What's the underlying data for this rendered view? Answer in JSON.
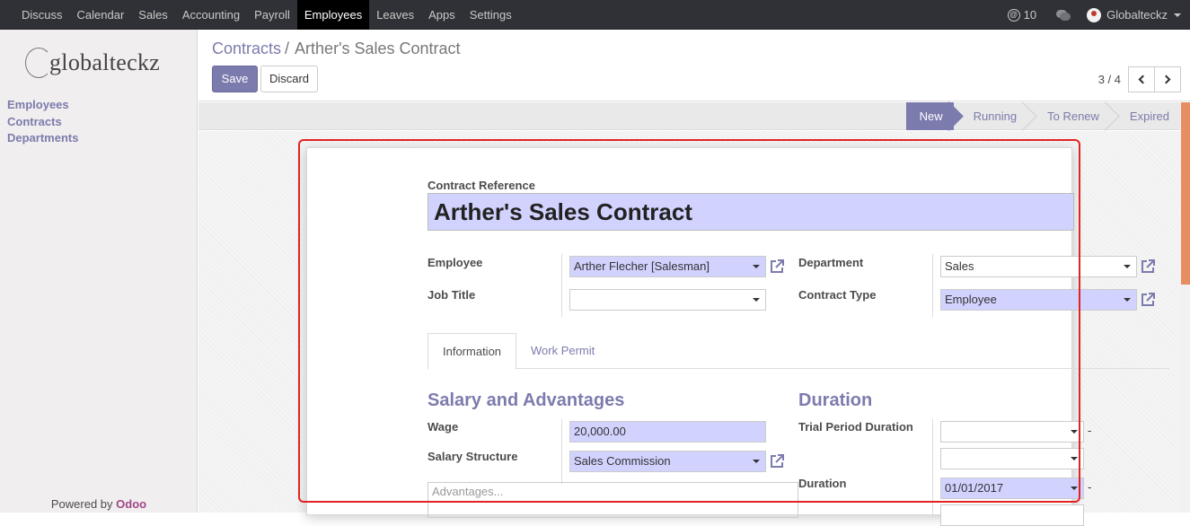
{
  "menu": [
    "Discuss",
    "Calendar",
    "Sales",
    "Accounting",
    "Payroll",
    "Employees",
    "Leaves",
    "Apps",
    "Settings"
  ],
  "active_menu": "Employees",
  "topbar": {
    "mentions_symbol": "@",
    "mentions_count": "10",
    "user_name": "Globalteckz"
  },
  "sidebar": {
    "logo_text": "globalteckz",
    "links": [
      "Employees",
      "Contracts",
      "Departments"
    ],
    "powered_by": "Powered by",
    "odoo": "Odoo"
  },
  "breadcrumb": {
    "parent": "Contracts",
    "separator": "/",
    "current": "Arther's Sales Contract"
  },
  "buttons": {
    "save": "Save",
    "discard": "Discard"
  },
  "pager": {
    "value": "3 / 4"
  },
  "status_stages": [
    "New",
    "Running",
    "To Renew",
    "Expired"
  ],
  "active_stage": "New",
  "form": {
    "contract_reference_label": "Contract Reference",
    "contract_reference": "Arther's Sales Contract",
    "employee_label": "Employee",
    "employee_value": "Arther Flecher [Salesman]",
    "job_title_label": "Job Title",
    "job_title_value": "",
    "department_label": "Department",
    "department_value": "Sales",
    "contract_type_label": "Contract Type",
    "contract_type_value": "Employee"
  },
  "tabs": [
    "Information",
    "Work Permit"
  ],
  "active_tab": "Information",
  "salary": {
    "title": "Salary and Advantages",
    "wage_label": "Wage",
    "wage_value": "20,000.00",
    "structure_label": "Salary Structure",
    "structure_value": "Sales Commission",
    "advantages_placeholder": "Advantages..."
  },
  "duration": {
    "title": "Duration",
    "trial_label": "Trial Period Duration",
    "trial_start": "",
    "trial_end": "",
    "duration_label": "Duration",
    "duration_start": "01/01/2017",
    "dash": "-"
  },
  "colors": {
    "brand": "#7c7bad",
    "topbar": "#2f3136",
    "required_field": "#d2d2ff",
    "highlight_box": "#e02424",
    "odoo": "#a24689",
    "scroll_thumb": "#e88d62"
  }
}
